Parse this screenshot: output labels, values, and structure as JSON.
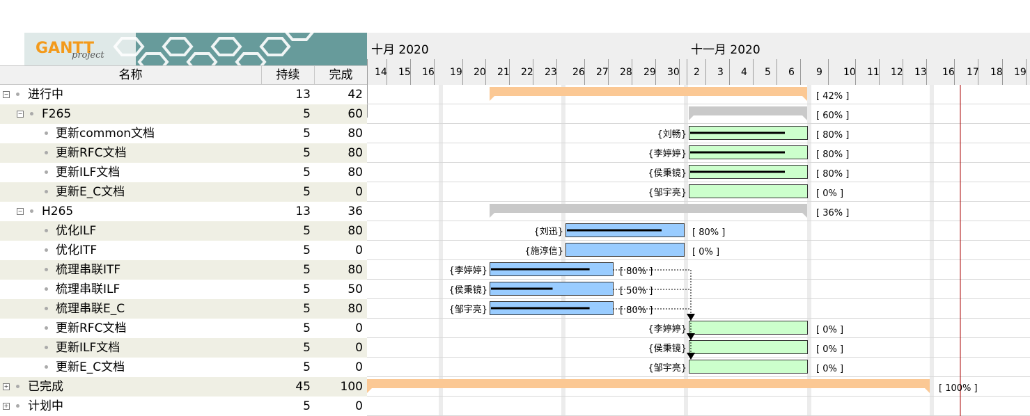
{
  "logo": {
    "brand": "GANTT",
    "sub": "project"
  },
  "columns": {
    "name": "名称",
    "duration": "持续",
    "complete": "完成"
  },
  "timeline": {
    "months": [
      "十月 2020",
      "十一月 2020"
    ],
    "days": [
      "14",
      "15",
      "16",
      "19",
      "20",
      "21",
      "22",
      "23",
      "26",
      "27",
      "28",
      "29",
      "30",
      "2",
      "3",
      "4",
      "5",
      "6",
      "9",
      "10",
      "11",
      "12",
      "13",
      "16",
      "17",
      "18",
      "19"
    ]
  },
  "tasks": [
    {
      "name": "进行中",
      "duration": "13",
      "complete": "42",
      "level": 0,
      "toggle": "⊟",
      "progress_label": "[ 42% ]",
      "resource": ""
    },
    {
      "name": "F265",
      "duration": "5",
      "complete": "60",
      "level": 1,
      "toggle": "⊟",
      "progress_label": "[ 60% ]",
      "resource": ""
    },
    {
      "name": "更新common文档",
      "duration": "5",
      "complete": "80",
      "level": 2,
      "toggle": "",
      "progress_label": "[ 80% ]",
      "resource": "{刘畅}"
    },
    {
      "name": "更新RFC文档",
      "duration": "5",
      "complete": "80",
      "level": 2,
      "toggle": "",
      "progress_label": "[ 80% ]",
      "resource": "{李婷婷}"
    },
    {
      "name": "更新ILF文档",
      "duration": "5",
      "complete": "80",
      "level": 2,
      "toggle": "",
      "progress_label": "[ 80% ]",
      "resource": "{侯秉镜}"
    },
    {
      "name": "更新E_C文档",
      "duration": "5",
      "complete": "0",
      "level": 2,
      "toggle": "",
      "progress_label": "[ 0% ]",
      "resource": "{邹宇亮}"
    },
    {
      "name": "H265",
      "duration": "13",
      "complete": "36",
      "level": 1,
      "toggle": "⊟",
      "progress_label": "[ 36% ]",
      "resource": ""
    },
    {
      "name": "优化ILF",
      "duration": "5",
      "complete": "80",
      "level": 2,
      "toggle": "",
      "progress_label": "[ 80% ]",
      "resource": "{刘迅}"
    },
    {
      "name": "优化ITF",
      "duration": "5",
      "complete": "0",
      "level": 2,
      "toggle": "",
      "progress_label": "[ 0% ]",
      "resource": "{施淳信}"
    },
    {
      "name": "梳理串联ITF",
      "duration": "5",
      "complete": "80",
      "level": 2,
      "toggle": "",
      "progress_label": "[ 80% ]",
      "resource": "{李婷婷}"
    },
    {
      "name": "梳理串联ILF",
      "duration": "5",
      "complete": "50",
      "level": 2,
      "toggle": "",
      "progress_label": "[ 50% ]",
      "resource": "{侯秉镜}"
    },
    {
      "name": "梳理串联E_C",
      "duration": "5",
      "complete": "80",
      "level": 2,
      "toggle": "",
      "progress_label": "[ 80% ]",
      "resource": "{邹宇亮}"
    },
    {
      "name": "更新RFC文档",
      "duration": "5",
      "complete": "0",
      "level": 2,
      "toggle": "",
      "progress_label": "[ 0% ]",
      "resource": "{李婷婷}"
    },
    {
      "name": "更新ILF文档",
      "duration": "5",
      "complete": "0",
      "level": 2,
      "toggle": "",
      "progress_label": "[ 0% ]",
      "resource": "{侯秉镜}"
    },
    {
      "name": "更新E_C文档",
      "duration": "5",
      "complete": "0",
      "level": 2,
      "toggle": "",
      "progress_label": "[ 0% ]",
      "resource": "{邹宇亮}"
    },
    {
      "name": "已完成",
      "duration": "45",
      "complete": "100",
      "level": 0,
      "toggle": "⊞",
      "progress_label": "[ 100% ]",
      "resource": ""
    },
    {
      "name": "计划中",
      "duration": "5",
      "complete": "0",
      "level": 0,
      "toggle": "⊞",
      "progress_label": "",
      "resource": ""
    }
  ],
  "colors": {
    "summary_top": "#fbc894",
    "summary_sub": "#c9c9c9",
    "f265_task": "#ccffcc",
    "h265_task": "#99ccff",
    "today_line": "#aa0000",
    "alt_row": "#efefe4"
  }
}
